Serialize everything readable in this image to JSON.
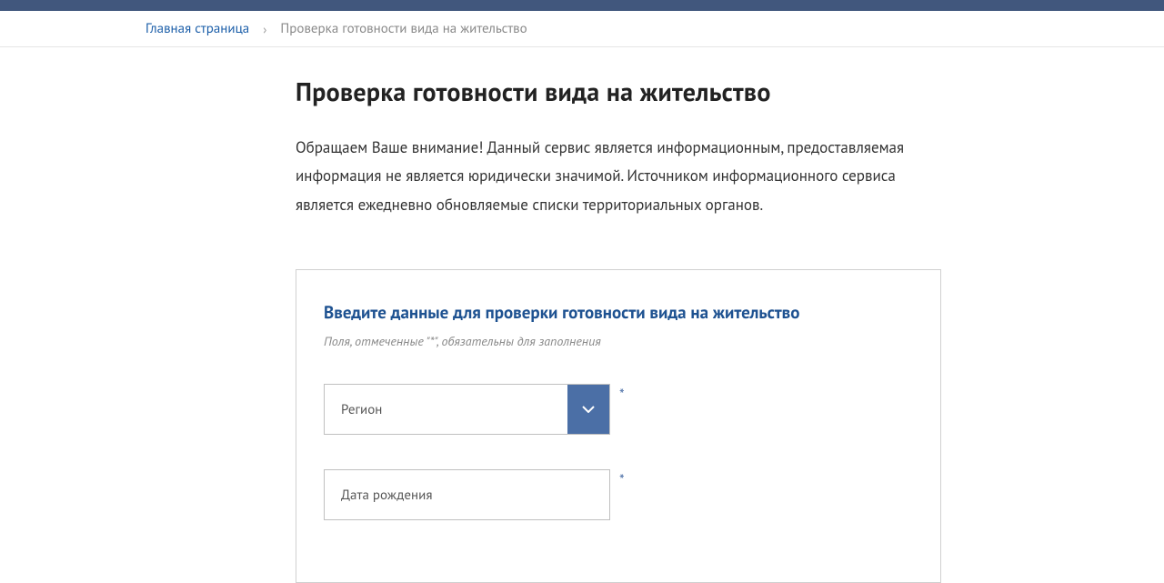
{
  "breadcrumb": {
    "home": "Главная страница",
    "current": "Проверка готовности вида на жительство"
  },
  "page": {
    "title": "Проверка готовности вида на жительство",
    "notice": "Обращаем Ваше внимание! Данный сервис является информационным, предоставляемая информация не является юридически значимой. Источником информационного сервиса является ежедневно обновляемые списки территориальных органов."
  },
  "form": {
    "title": "Введите данные для проверки готовности вида на жительство",
    "hint": "Поля, отмеченные \"*\", обязательны для заполнения",
    "required_mark": "*",
    "region": {
      "label": "Регион"
    },
    "birthdate": {
      "placeholder": "Дата рождения"
    }
  }
}
